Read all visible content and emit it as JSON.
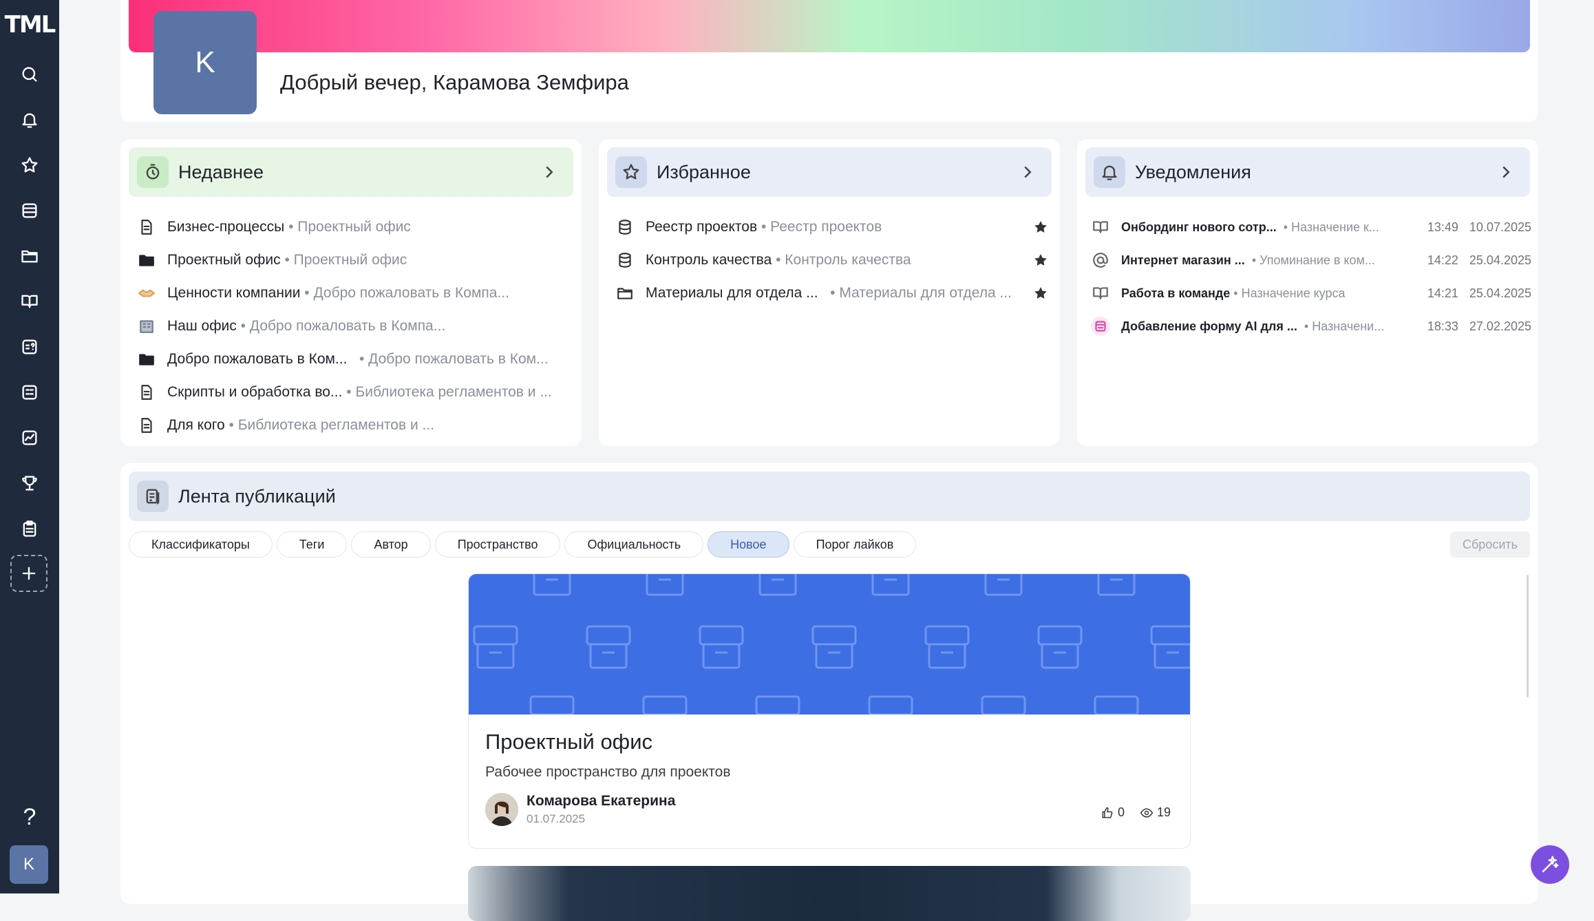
{
  "app": {
    "logo": "TML"
  },
  "sidebar": {
    "help": "?",
    "user_initial": "K",
    "items": [
      "search-icon",
      "bell-icon",
      "star-icon",
      "database-icon",
      "folder-icon",
      "book-icon",
      "quiz-icon",
      "grid-icon",
      "chart-icon",
      "trophy-icon",
      "clipboard-icon",
      "plus-icon"
    ]
  },
  "header": {
    "avatar_initial": "K",
    "greeting": "Добрый вечер, Карамова Земфира",
    "banner_colors": [
      "#fb2f7a",
      "#ffb0c0",
      "#b8f5c6",
      "#a8c6f0",
      "#9aa8e8"
    ]
  },
  "recent": {
    "title": "Недавнее",
    "accent": "#e6f5e4",
    "items": [
      {
        "title": "Бизнес-процессы",
        "sub": "• Проектный офис",
        "icon": "document-icon"
      },
      {
        "title": "Проектный офис",
        "sub": "• Проектный офис",
        "icon": "folder-icon"
      },
      {
        "title": "Ценности компании",
        "sub": "• Добро пожаловать в Компа...",
        "icon": "handshake-icon"
      },
      {
        "title": "Наш офис",
        "sub": "• Добро пожаловать в Компа...",
        "icon": "office-icon"
      },
      {
        "title": "Добро пожаловать в Ком...",
        "sub": "• Добро пожаловать в Ком...",
        "icon": "folder-icon"
      },
      {
        "title": "Скрипты и обработка во...",
        "sub": "• Библиотека регламентов и ...",
        "icon": "document-icon"
      },
      {
        "title": "Для кого",
        "sub": "• Библиотека регламентов и ...",
        "icon": "document-icon"
      }
    ]
  },
  "favorites": {
    "title": "Избранное",
    "accent": "#e8edf8",
    "items": [
      {
        "title": "Реестр проектов",
        "sub": "• Реестр проектов",
        "icon": "database-icon"
      },
      {
        "title": "Контроль качества",
        "sub": "• Контроль качества",
        "icon": "database-icon"
      },
      {
        "title": "Материалы для отдела ...",
        "sub": "• Материалы для отдела ...",
        "icon": "folder-icon"
      }
    ]
  },
  "notifications": {
    "title": "Уведомления",
    "accent": "#e8edf8",
    "items": [
      {
        "title": "Онбординг нового сотр...",
        "sub": "• Назначение к...",
        "time": "13:49",
        "date": "10.07.2025",
        "icon": "book-icon"
      },
      {
        "title": "Интернет магазин ...",
        "sub": "• Упоминание в ком...",
        "time": "14:22",
        "date": "25.04.2025",
        "icon": "at-icon"
      },
      {
        "title": "Работа в команде",
        "sub": "• Назначение курса",
        "time": "14:21",
        "date": "25.04.2025",
        "icon": "book-icon"
      },
      {
        "title": "Добавление форму AI для ...",
        "sub": "• Назначени...",
        "time": "18:33",
        "date": "27.02.2025",
        "icon": "form-icon"
      }
    ]
  },
  "feed": {
    "title": "Лента публикаций",
    "filters": [
      "Классификаторы",
      "Теги",
      "Автор",
      "Пространство",
      "Официальность",
      "Новое",
      "Порог лайков"
    ],
    "active_filter": "Новое",
    "reset_label": "Сбросить",
    "post": {
      "title": "Проектный офис",
      "subtitle": "Рабочее пространство для проектов",
      "author": "Комарова Екатерина",
      "date": "01.07.2025",
      "likes": "0",
      "views": "19",
      "cover_color": "#3d6ee4"
    }
  }
}
